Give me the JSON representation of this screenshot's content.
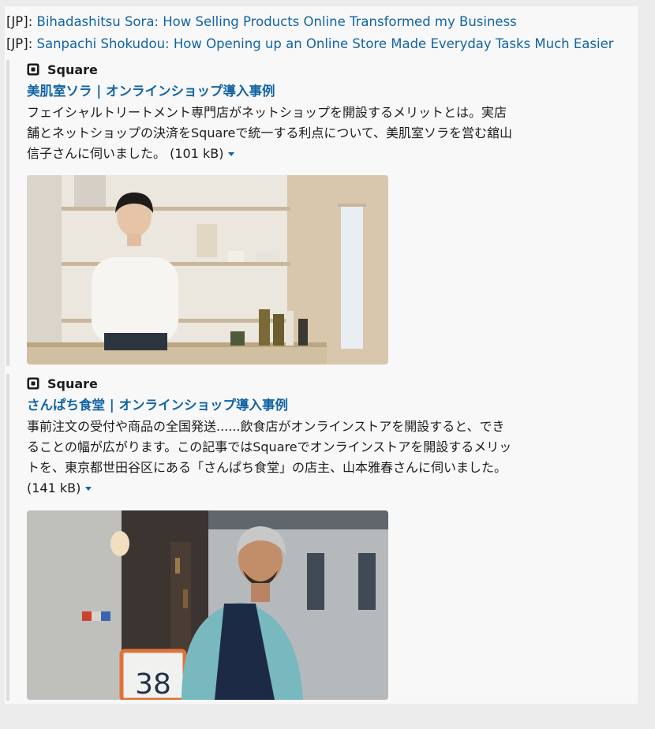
{
  "links": [
    {
      "prefix": "[JP]: ",
      "text": "Bihadashitsu Sora: How Selling Products Online Transformed my Business"
    },
    {
      "prefix": "[JP]: ",
      "text": "Sanpachi Shokudou: How Opening up an Online Store Made Everyday Tasks Much Easier"
    }
  ],
  "attachments": [
    {
      "service": "Square",
      "title": "美肌室ソラ | オンラインショップ導入事例",
      "desc_lines": [
        "フェイシャルトリートメント専門店がネットショップを開設するメリットとは。実店",
        "舗とネットショップの決済をSquareで統一する利点について、美肌室ソラを営む舘山",
        "信子さんに伺いました。"
      ],
      "size": "(101 kB)",
      "image_icon": "photo-woman-in-shop"
    },
    {
      "service": "Square",
      "title": "さんぱち食堂 | オンラインショップ導入事例",
      "desc_lines": [
        "事前注文の受付や商品の全国発送......飲食店がオンラインストアを開設すると、でき",
        "ることの幅が広がります。この記事ではSquareでオンラインストアを開設するメリッ",
        "トを、東京都世田谷区にある「さんぱち食堂」の店主、山本雅春さんに伺いました。"
      ],
      "size": "(141 kB)",
      "image_icon": "photo-man-outside-restaurant",
      "sign_text": "38"
    }
  ],
  "colors": {
    "link": "#1264a3",
    "text": "#1d1c1d",
    "border": "#dddddd"
  }
}
